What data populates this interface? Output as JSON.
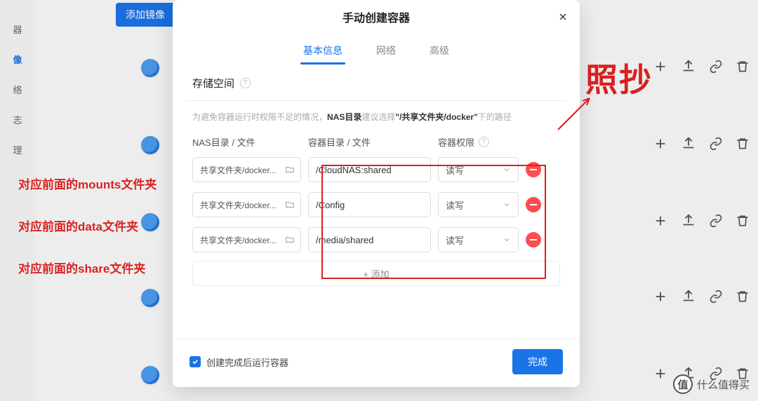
{
  "sidebar": {
    "items": [
      "器",
      "像",
      "络",
      "志",
      "理"
    ]
  },
  "chip": {
    "label": "添加镜像"
  },
  "modal": {
    "title": "手动创建容器",
    "tabs": [
      "基本信息",
      "网络",
      "高级"
    ],
    "section": "存储空间",
    "hint_prefix": "为避免容器运行时权限不足的情况，",
    "hint_bold": "NAS目录",
    "hint_mid": "建议选择",
    "hint_path": "\"/共享文件夹/docker\"",
    "hint_suffix": "下的路径",
    "headers": {
      "nas": "NAS目录 / 文件",
      "container": "容器目录 / 文件",
      "perm": "容器权限"
    },
    "rows": [
      {
        "nas": "共享文件夹/docker...",
        "container": "/CloudNAS:shared",
        "perm": "读写"
      },
      {
        "nas": "共享文件夹/docker...",
        "container": "/Config",
        "perm": "读写"
      },
      {
        "nas": "共享文件夹/docker...",
        "container": "/media/shared",
        "perm": "读写"
      }
    ],
    "add_label": "+ 添加",
    "checkbox_label": "创建完成后运行容器",
    "finish_label": "完成"
  },
  "annotations": {
    "big": "照抄",
    "row0": "对应前面的mounts文件夹",
    "row1": "对应前面的data文件夹",
    "row2": "对应前面的share文件夹"
  },
  "watermark": {
    "text": "什么值得买",
    "badge": "值"
  }
}
